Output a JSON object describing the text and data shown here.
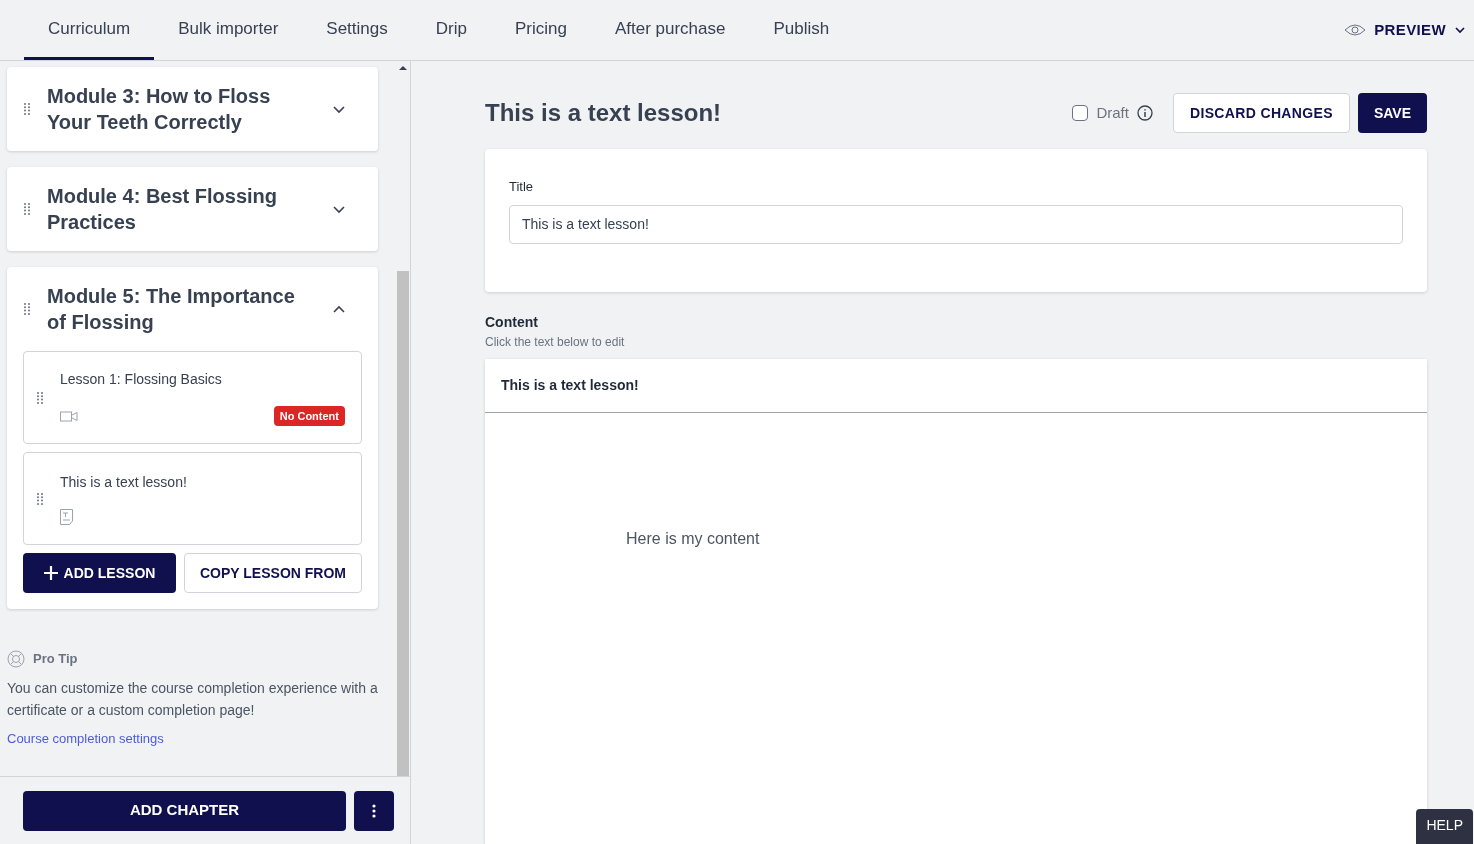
{
  "tabs": [
    {
      "label": "Curriculum",
      "selected": true
    },
    {
      "label": "Bulk importer",
      "selected": false
    },
    {
      "label": "Settings",
      "selected": false
    },
    {
      "label": "Drip",
      "selected": false
    },
    {
      "label": "Pricing",
      "selected": false
    },
    {
      "label": "After purchase",
      "selected": false
    },
    {
      "label": "Publish",
      "selected": false
    }
  ],
  "preview": {
    "label": "PREVIEW"
  },
  "modules": [
    {
      "title": "Module 3: How to Floss Your Teeth Correctly",
      "expanded": false
    },
    {
      "title": "Module 4: Best Flossing Practices",
      "expanded": false
    },
    {
      "title": "Module 5: The Importance of Flossing",
      "expanded": true,
      "lessons": [
        {
          "title": "Lesson 1: Flossing Basics",
          "kind": "video",
          "badge": "No Content"
        },
        {
          "title": "This is a text lesson!",
          "kind": "text"
        }
      ],
      "add_lesson": "ADD LESSON",
      "copy_lesson": "COPY LESSON FROM"
    }
  ],
  "pro_tip": {
    "heading": "Pro Tip",
    "text": "You can customize the course completion experience with a certificate or a custom completion page!",
    "link": "Course completion settings"
  },
  "add_chapter": "ADD CHAPTER",
  "lesson": {
    "heading": "This is a text lesson!",
    "draft": {
      "label": "Draft",
      "checked": false
    },
    "discard": "DISCARD CHANGES",
    "save": "SAVE",
    "title_label": "Title",
    "title_value": "This is a text lesson!",
    "content_label": "Content",
    "content_hint": "Click the text below to edit",
    "content_heading": "This is a text lesson!",
    "content_body": "Here is my content"
  },
  "help": "HELP"
}
